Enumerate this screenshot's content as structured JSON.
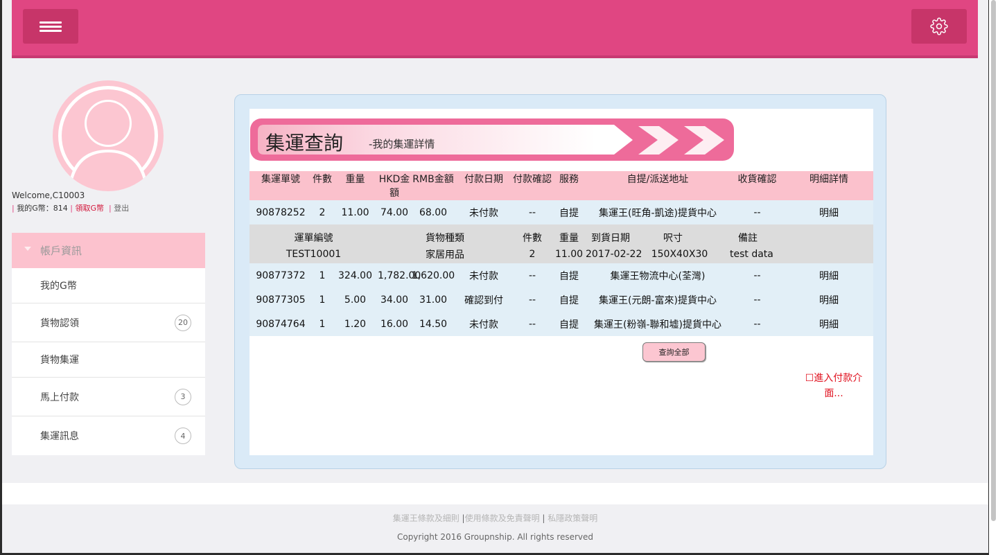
{
  "sidebar": {
    "welcome": "Welcome,C10003",
    "g_label": "我的G幣：814",
    "claim_label": "領取G幣",
    "logout_label": "登出",
    "header": "帳戶資訊",
    "items": [
      {
        "label": "我的G幣",
        "badge": ""
      },
      {
        "label": "貨物認領",
        "badge": "20"
      },
      {
        "label": "貨物集運",
        "badge": ""
      },
      {
        "label": "馬上付款",
        "badge": "3"
      },
      {
        "label": "集運訊息",
        "badge": "4"
      }
    ]
  },
  "banner": {
    "title": "集運查詢",
    "subtitle": "-我的集運詳情"
  },
  "table": {
    "headers": [
      "集運單號",
      "件數",
      "重量",
      "HKD金額",
      "RMB金額",
      "付款日期",
      "付款確認",
      "服務",
      "自提/派送地址",
      "收貨確認",
      "明細詳情"
    ],
    "rows": [
      {
        "no": "90878252",
        "qty": "2",
        "weight": "11.00",
        "hkd": "74.00",
        "rmb": "68.00",
        "pay_date": "未付款",
        "pay_confirm": "--",
        "service": "自提",
        "address": "集運王(旺角-凱途)提貨中心",
        "receive": "--",
        "detail": "明細"
      },
      {
        "no": "90877372",
        "qty": "1",
        "weight": "324.00",
        "hkd": "1,782.00",
        "rmb": "1,620.00",
        "pay_date": "未付款",
        "pay_confirm": "--",
        "service": "自提",
        "address": "集運王物流中心(荃灣)",
        "receive": "--",
        "detail": "明細"
      },
      {
        "no": "90877305",
        "qty": "1",
        "weight": "5.00",
        "hkd": "34.00",
        "rmb": "31.00",
        "pay_date": "確認到付",
        "pay_confirm": "--",
        "service": "自提",
        "address": "集運王(元朗-富來)提貨中心",
        "receive": "--",
        "detail": "明細"
      },
      {
        "no": "90874764",
        "qty": "1",
        "weight": "1.20",
        "hkd": "16.00",
        "rmb": "14.50",
        "pay_date": "未付款",
        "pay_confirm": "--",
        "service": "自提",
        "address": "集運王(粉嶺-聯和墟)提貨中心",
        "receive": "--",
        "detail": "明細"
      }
    ],
    "sub_headers": [
      "運單編號",
      "貨物種類",
      "件數",
      "重量",
      "到貨日期",
      "呎寸",
      "備註"
    ],
    "sub_row": [
      "TEST10001",
      "家居用品",
      "2",
      "11.00",
      "2017-02-22",
      "150X40X30",
      "test data"
    ]
  },
  "actions": {
    "query_all": "查詢全部",
    "pay_link": "☐進入付款介面..."
  },
  "footer": {
    "links": [
      "集運王條款及細則",
      "使用條款及免責聲明",
      "私隱政策聲明"
    ],
    "sep1": "|",
    "sep2": "|",
    "copyright": "Copyright 2016 Groupnship. All rights reserved"
  },
  "colors": {
    "accent": "#e04682",
    "pink_light": "#fcc2ce",
    "panel_blue": "#daeaf7",
    "alert_red": "#e0101e",
    "confirm_green": "#2a8a2a"
  },
  "icons": {
    "menu": "hamburger-menu-icon",
    "settings": "gear-icon",
    "avatar": "user-avatar-icon"
  }
}
